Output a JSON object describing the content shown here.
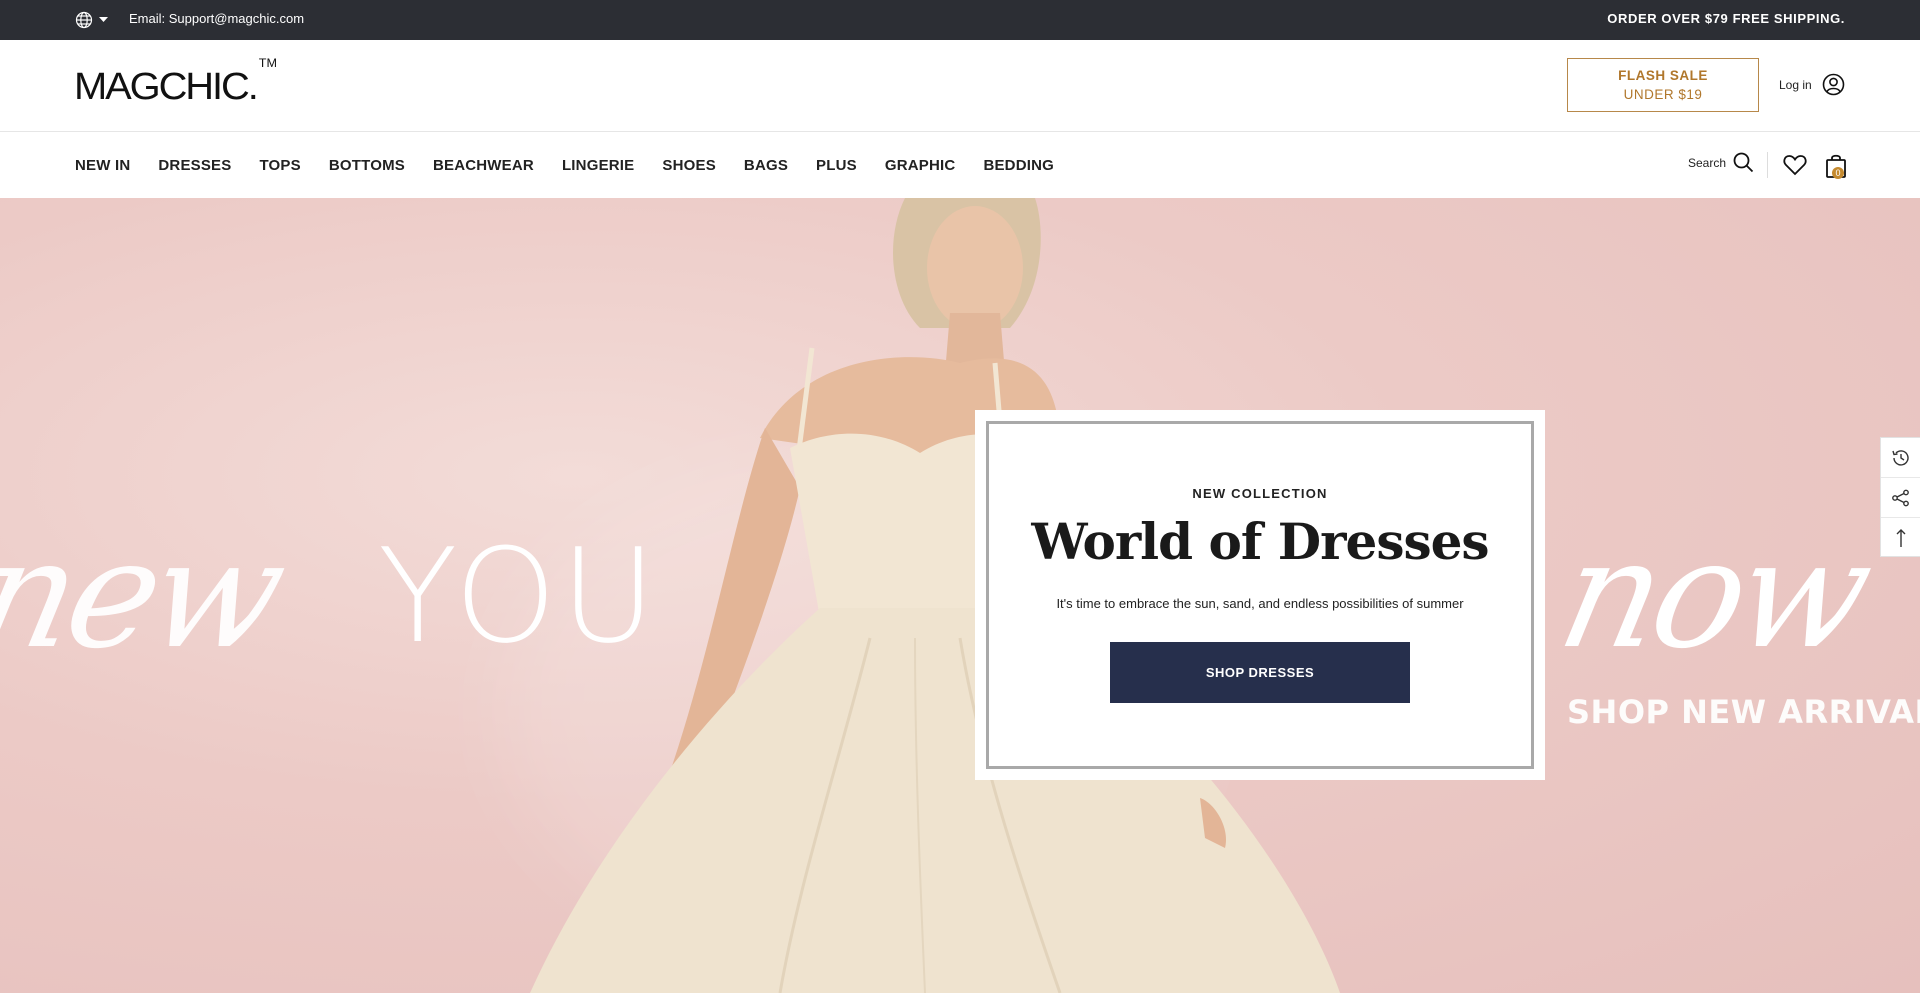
{
  "topbar": {
    "email": "Email: Support@magchic.com",
    "shipping": "ORDER OVER $79 FREE SHIPPING.",
    "language_icon": "globe-icon"
  },
  "header": {
    "logo": "MAGCHIC.",
    "logo_tm": "TM",
    "flash_sale_line1": "FLASH SALE",
    "flash_sale_line2": "UNDER $19",
    "login_label": "Log in",
    "account_icon": "user-circle-icon"
  },
  "nav": {
    "items": [
      "NEW IN",
      "DRESSES",
      "TOPS",
      "BOTTOMS",
      "BEACHWEAR",
      "LINGERIE",
      "SHOES",
      "BAGS",
      "PLUS",
      "GRAPHIC",
      "BEDDING"
    ],
    "search_label": "Search",
    "cart_count": "0"
  },
  "hero": {
    "bg_script_left": "new",
    "bg_you": "YOU",
    "bg_script_right": "now",
    "bg_shop_arrival": "SHOP NEW ARRIVAL",
    "kicker": "NEW COLLECTION",
    "title": "World of Dresses",
    "description": "It's time to embrace the sun, sand, and endless possibilities of summer",
    "button": "SHOP DRESSES"
  },
  "sidetools": [
    "history-icon",
    "share-icon",
    "back-to-top-icon"
  ],
  "colors": {
    "topbar_bg": "#2c2e34",
    "flash_accent": "#b0772c",
    "button_bg": "#262f4c",
    "hero_bg": "#eccac6"
  }
}
